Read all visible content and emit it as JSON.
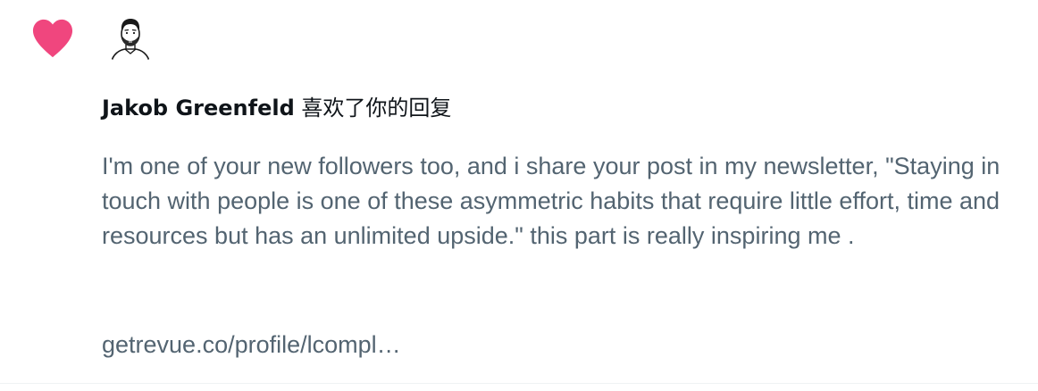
{
  "notification": {
    "type_icon": "heart-icon",
    "icon_color": "#f0467e",
    "user_name": "Jakob Greenfeld",
    "action_text": " 喜欢了你的回复",
    "reply_text": "I'm one of your new followers too, and i share your post in my newsletter, \"Staying in touch with people is one of these asymmetric habits that require little effort, time and resources but has an unlimited upside.\" this part is really inspiring me .",
    "link_text": "getrevue.co/profile/lcompl…"
  },
  "colors": {
    "heading": "#0f1419",
    "secondary_text": "#536471",
    "heart": "#f0467e"
  }
}
